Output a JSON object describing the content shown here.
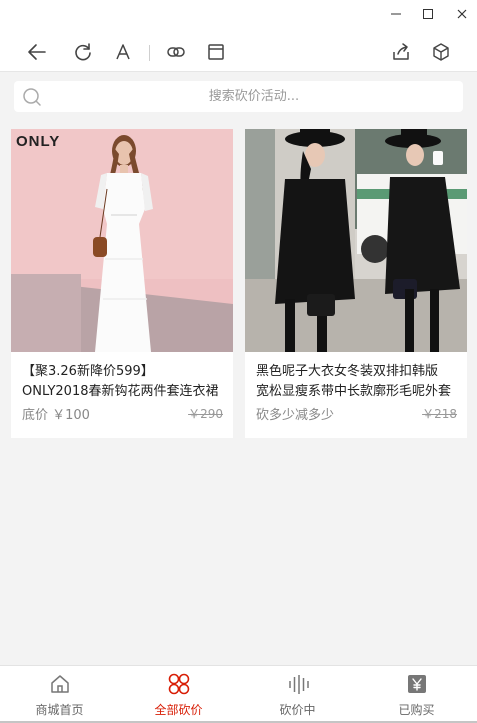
{
  "window": {
    "minimize": "—",
    "maximize": "☐",
    "close": "✕"
  },
  "search": {
    "placeholder": "搜索砍价活动..."
  },
  "products": [
    {
      "title_line1": "【聚3.26新降价599】",
      "title_line2": "ONLY2018春新钩花两件套连衣裙",
      "price": "底价 ￥100",
      "original_price": "￥290",
      "brand_logo": "ONLY"
    },
    {
      "title_line1": "黑色呢子大衣女冬装双排扣韩版",
      "title_line2": "宽松显瘦系带中长款廓形毛呢外套",
      "price": "砍多少减多少",
      "original_price": "￥218"
    }
  ],
  "tabs": [
    {
      "label": "商城首页",
      "icon": "home-icon"
    },
    {
      "label": "全部砍价",
      "icon": "grid-icon"
    },
    {
      "label": "砍价中",
      "icon": "bars-icon"
    },
    {
      "label": "已购买",
      "icon": "yen-icon"
    }
  ],
  "colors": {
    "accent": "#d81e06",
    "background": "#f3f3f3"
  }
}
